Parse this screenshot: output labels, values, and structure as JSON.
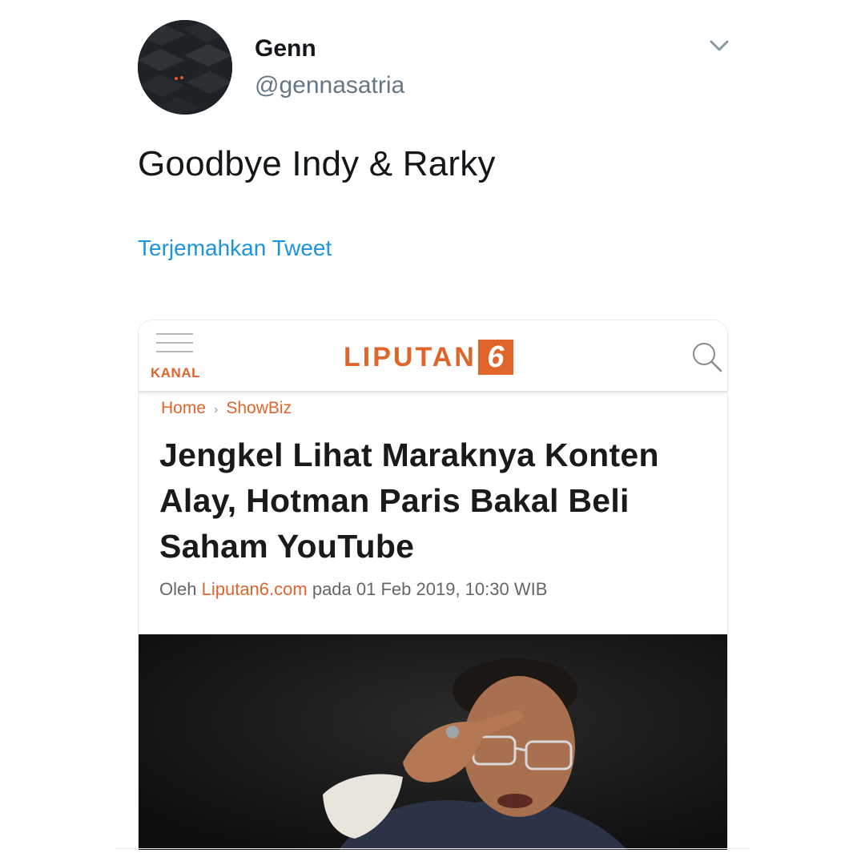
{
  "tweet": {
    "user": {
      "name": "Genn",
      "handle": "@gennasatria"
    },
    "text": "Goodbye Indy & Rarky",
    "translate_label": "Terjemahkan Tweet"
  },
  "article": {
    "site": {
      "menu_label": "KANAL",
      "logo_text": "LIPUTAN",
      "logo_number": "6"
    },
    "breadcrumb": {
      "home": "Home",
      "separator": "›",
      "section": "ShowBiz"
    },
    "headline": "Jengkel Lihat Maraknya Konten Alay, Hotman Paris Bakal Beli Saham YouTube",
    "byline": {
      "prefix": "Oleh",
      "source": "Liputan6.com",
      "middle": "pada",
      "datetime": "01 Feb 2019, 10:30 WIB"
    }
  },
  "colors": {
    "brand_orange": "#e0652b",
    "twitter_link": "#1b95e0",
    "handle_gray": "#657786"
  },
  "icons": {
    "caret": "chevron-down-icon",
    "menu": "hamburger-menu-icon",
    "search": "search-icon"
  }
}
